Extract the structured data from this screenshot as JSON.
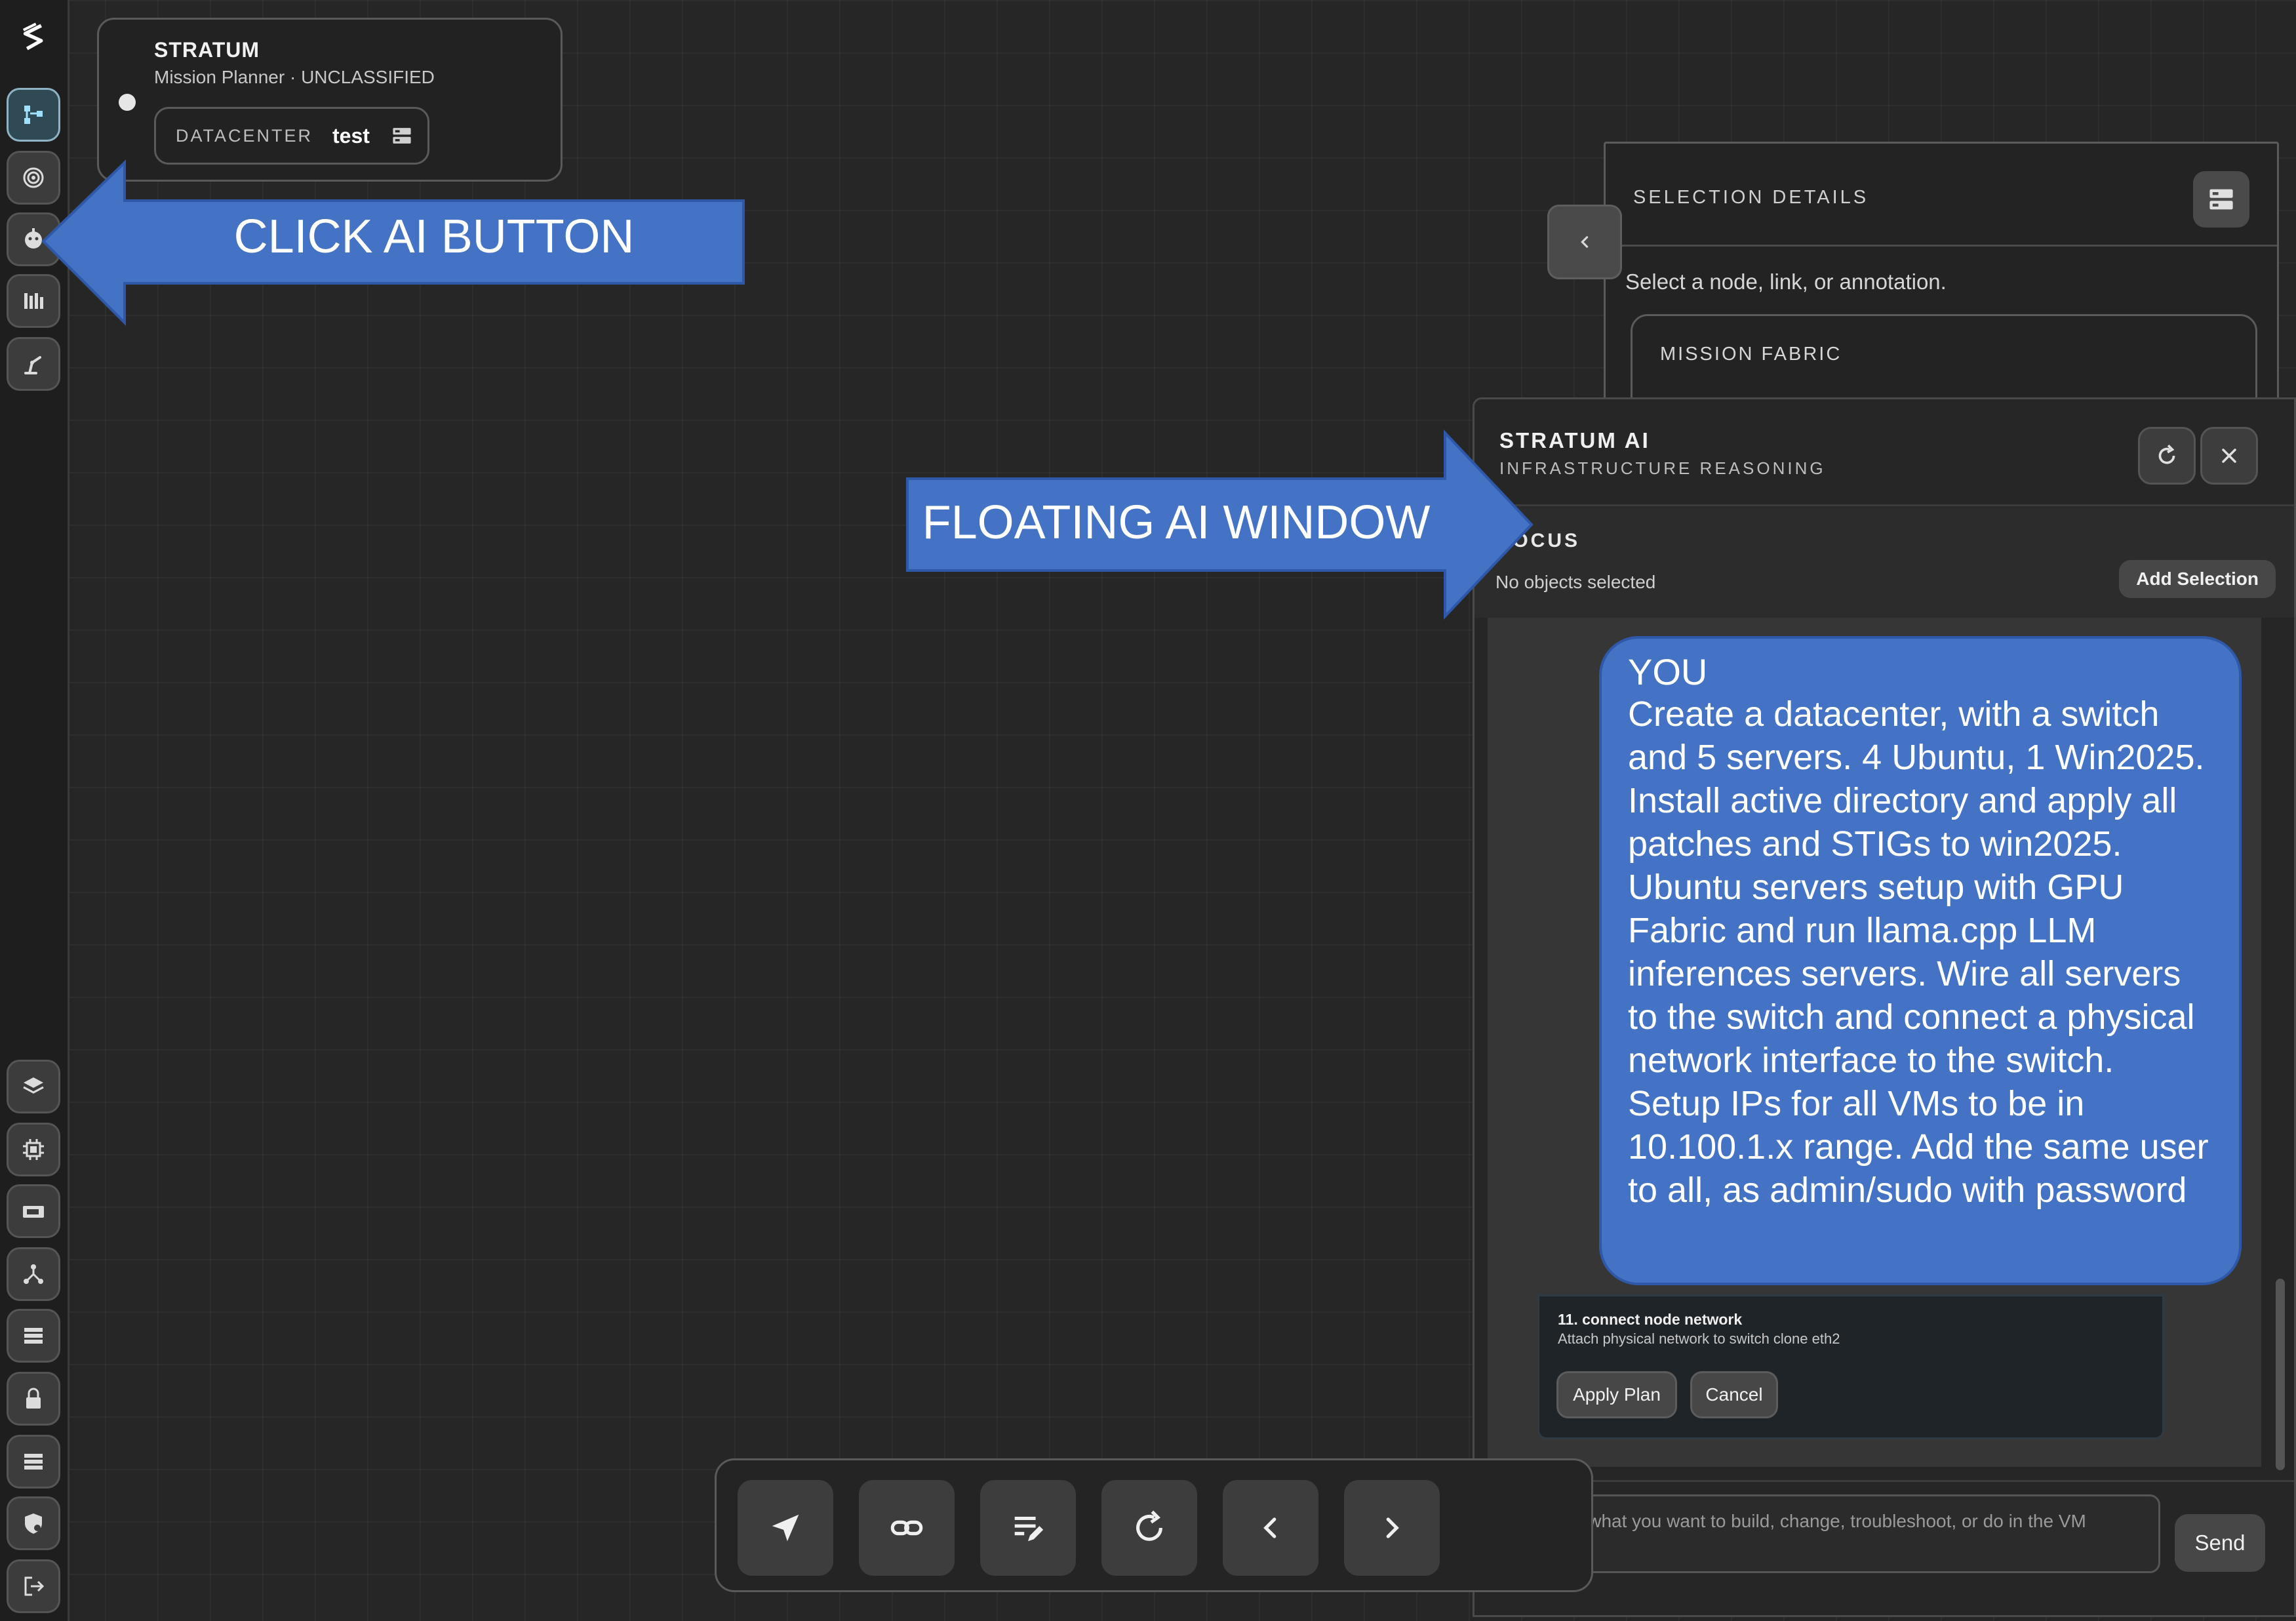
{
  "header": {
    "app_name": "STRATUM",
    "subtitle": "Mission Planner · UNCLASSIFIED",
    "datacenter_label": "DATACENTER",
    "datacenter_value": "test"
  },
  "annotations": {
    "ai_button_callout": "CLICK AI BUTTON",
    "ai_window_callout": "FLOATING AI WINDOW",
    "arrow_color": "#4472c4"
  },
  "selection_panel": {
    "title": "SELECTION DETAILS",
    "empty_message": "Select a node, link, or annotation.",
    "section_title": "MISSION FABRIC"
  },
  "ai_window": {
    "title": "STRATUM AI",
    "subtitle": "INFRASTRUCTURE REASONING",
    "focus_label": "FOCUS",
    "focus_value": "No objects selected",
    "add_selection_label": "Add Selection",
    "message": {
      "author": "YOU",
      "text": "Create a datacenter, with a switch and 5 servers. 4 Ubuntu, 1 Win2025. Install active directory and apply all patches and STIGs to win2025. Ubuntu servers setup with GPU Fabric and run llama.cpp LLM inferences servers. Wire all servers to the switch and connect a physical network interface to the switch. Setup IPs for all VMs to be in 10.100.1.x range. Add the same user to all, as admin/sudo with password"
    },
    "plan_step_title": "11. connect node network",
    "plan_step_desc": "Attach physical network to switch clone eth2",
    "apply_label": "Apply Plan",
    "cancel_label": "Cancel",
    "input_placeholder": "Describe what you want to build, change, troubleshoot, or do in the VM console...",
    "send_label": "Send"
  },
  "icons": {
    "rail_top": [
      "topology-icon",
      "target-icon",
      "ai-bot-icon",
      "inventory-icon",
      "robot-arm-icon"
    ],
    "rail_bottom": [
      "layers-icon",
      "cpu-icon",
      "drive-icon",
      "network-icon",
      "list-icon",
      "lock-icon",
      "list-icon",
      "shield-icon",
      "logout-icon"
    ],
    "toolbar": [
      "send-icon",
      "link-icon",
      "edit-list-icon",
      "refresh-icon",
      "chevron-left-icon",
      "chevron-right-icon"
    ]
  },
  "colors": {
    "accent_active": "#9fe0ff",
    "message_bubble": "#4472c4"
  }
}
